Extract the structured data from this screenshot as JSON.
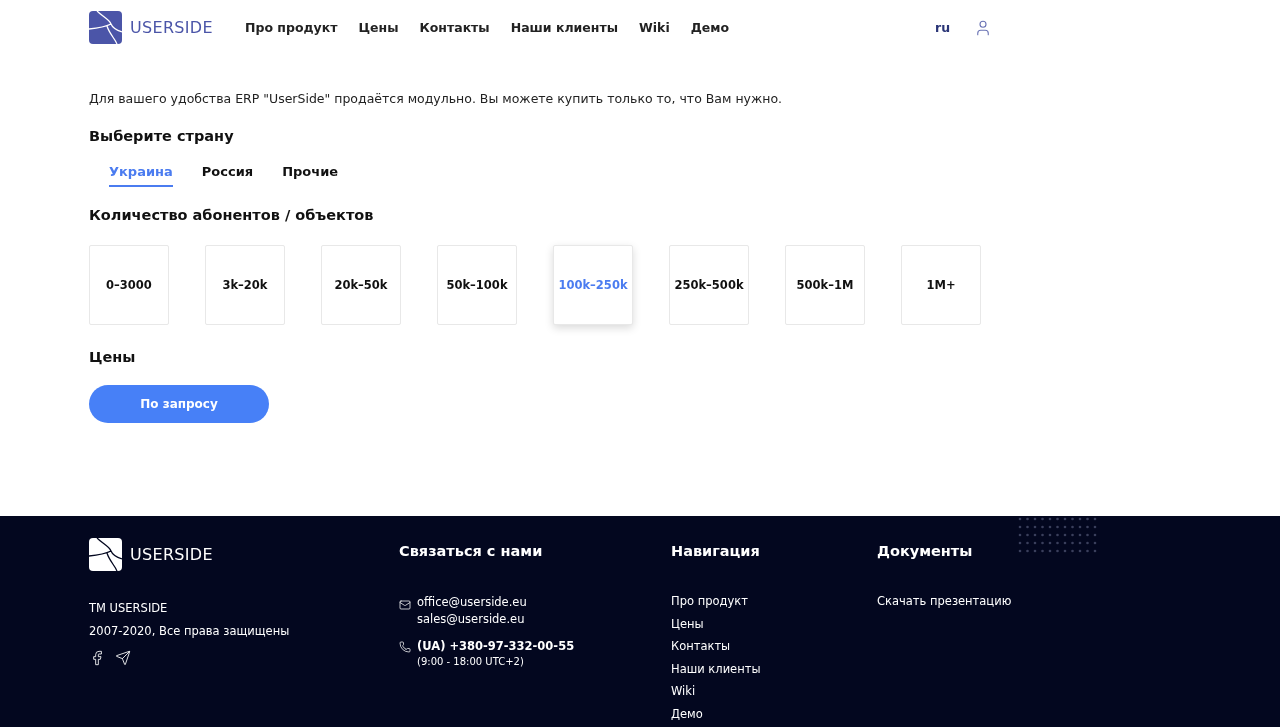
{
  "header": {
    "logo": "USERSIDE",
    "nav": [
      "Про продукт",
      "Цены",
      "Контакты",
      "Наши клиенты",
      "Wiki",
      "Демо"
    ],
    "language": {
      "label": "ru",
      "selected": true
    }
  },
  "intro": "Для вашего удобства ERP \"UserSide\" продаётся модульно. Вы можете купить только то, что Вам нужно.",
  "country": {
    "title": "Выберите страну",
    "tabs": [
      {
        "label": "Украина",
        "selected": true
      },
      {
        "label": "Россия",
        "selected": false
      },
      {
        "label": "Прочие",
        "selected": false
      }
    ]
  },
  "subscribers": {
    "title": "Количество абонентов / объектов",
    "options": [
      {
        "label": "0–3000",
        "selected": false
      },
      {
        "label": "3k–20k",
        "selected": false
      },
      {
        "label": "20k–50k",
        "selected": false
      },
      {
        "label": "50k–100k",
        "selected": false
      },
      {
        "label": "100k–250k",
        "selected": true
      },
      {
        "label": "250k–500k",
        "selected": false
      },
      {
        "label": "500k–1M",
        "selected": false
      },
      {
        "label": "1M+",
        "selected": false
      }
    ]
  },
  "prices": {
    "title": "Цены",
    "button": "По запросу"
  },
  "footer": {
    "logo": "USERSIDE",
    "trademark": "TM USERSIDE",
    "copyright": "2007-2020, Все права защищены",
    "contact": {
      "title": "Связаться с нами",
      "emails": [
        "office@userside.eu",
        "sales@userside.eu"
      ],
      "phone": "(UA) +380-97-332-00-55",
      "hours": "(9:00 - 18:00 UTC+2)"
    },
    "navigation": {
      "title": "Навигация",
      "links": [
        "Про продукт",
        "Цены",
        "Контакты",
        "Наши клиенты",
        "Wiki",
        "Демо"
      ]
    },
    "documents": {
      "title": "Документы",
      "links": [
        "Скачать презентацию"
      ]
    }
  }
}
